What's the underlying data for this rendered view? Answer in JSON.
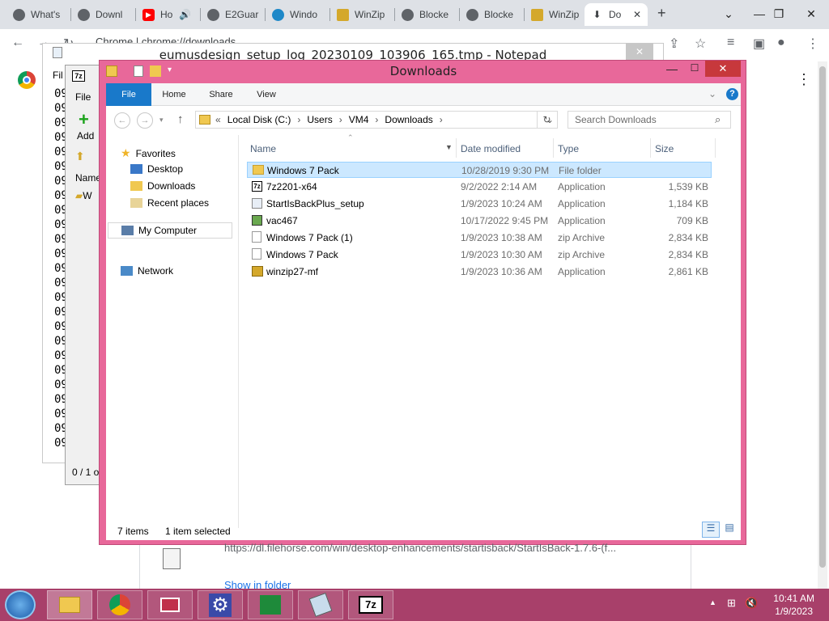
{
  "chrome": {
    "tabs": [
      {
        "label": "What's",
        "fav": "chrome-icon"
      },
      {
        "label": "Downl",
        "fav": "chrome-icon"
      },
      {
        "label": "Ho",
        "fav": "youtube-icon"
      },
      {
        "label": "E2Guar",
        "fav": "chrome-icon"
      },
      {
        "label": "Windo",
        "fav": "edge-icon"
      },
      {
        "label": "WinZip",
        "fav": "winzip-icon"
      },
      {
        "label": "Blocke",
        "fav": "chrome-icon"
      },
      {
        "label": "Blocke",
        "fav": "chrome-icon"
      },
      {
        "label": "WinZip",
        "fav": "winzip-icon"
      },
      {
        "label": "Do",
        "fav": "download-icon"
      }
    ],
    "address": "Chrome  |  chrome://downloads",
    "download": {
      "url": "https://dl.filehorse.com/win/desktop-enhancements/startisback/StartIsBack-1.7.6-(f...",
      "show_in_folder": "Show in folder"
    }
  },
  "notepad": {
    "title": "eumusdesign_setup_log_20230109_103906_165.tmp - Notepad",
    "menu_first": "Fil",
    "line_prefix": "09"
  },
  "sevenzip": {
    "menu_first": "File",
    "add_label": "Add",
    "name_header": "Name",
    "item": "W",
    "status": "0 / 1 o"
  },
  "explorer": {
    "title": "Downloads",
    "ribbon": {
      "file": "File",
      "home": "Home",
      "share": "Share",
      "view": "View"
    },
    "breadcrumb": [
      "Local Disk (C:)",
      "Users",
      "VM4",
      "Downloads"
    ],
    "breadcrumb_prefix": "«",
    "search_placeholder": "Search Downloads",
    "nav": {
      "favorites": "Favorites",
      "desktop": "Desktop",
      "downloads": "Downloads",
      "recent": "Recent places",
      "computer": "My Computer",
      "network": "Network"
    },
    "columns": {
      "name": "Name",
      "date": "Date modified",
      "type": "Type",
      "size": "Size"
    },
    "files": [
      {
        "name": "Windows 7 Pack",
        "date": "10/28/2019 9:30 PM",
        "type": "File folder",
        "size": "",
        "icon": "folder-icon"
      },
      {
        "name": "7z2201-x64",
        "date": "9/2/2022 2:14 AM",
        "type": "Application",
        "size": "1,539 KB",
        "icon": "7z-app-icon"
      },
      {
        "name": "StartIsBackPlus_setup",
        "date": "1/9/2023 10:24 AM",
        "type": "Application",
        "size": "1,184 KB",
        "icon": "app-icon"
      },
      {
        "name": "vac467",
        "date": "10/17/2022 9:45 PM",
        "type": "Application",
        "size": "709 KB",
        "icon": "app-icon"
      },
      {
        "name": "Windows 7 Pack (1)",
        "date": "1/9/2023 10:38 AM",
        "type": "zip Archive",
        "size": "2,834 KB",
        "icon": "zip-file-icon"
      },
      {
        "name": "Windows 7 Pack",
        "date": "1/9/2023 10:30 AM",
        "type": "zip Archive",
        "size": "2,834 KB",
        "icon": "zip-file-icon"
      },
      {
        "name": "winzip27-mf",
        "date": "1/9/2023 10:36 AM",
        "type": "Application",
        "size": "2,861 KB",
        "icon": "installer-icon"
      }
    ],
    "status": {
      "count": "7 items",
      "selected": "1 item selected"
    }
  },
  "taskbar": {
    "time": "10:41 AM",
    "date": "1/9/2023"
  },
  "colors": {
    "explorer_frame": "#e8689a",
    "taskbar": "#a8406a",
    "selection": "#cce8ff",
    "ribbon_file": "#1979ca"
  }
}
